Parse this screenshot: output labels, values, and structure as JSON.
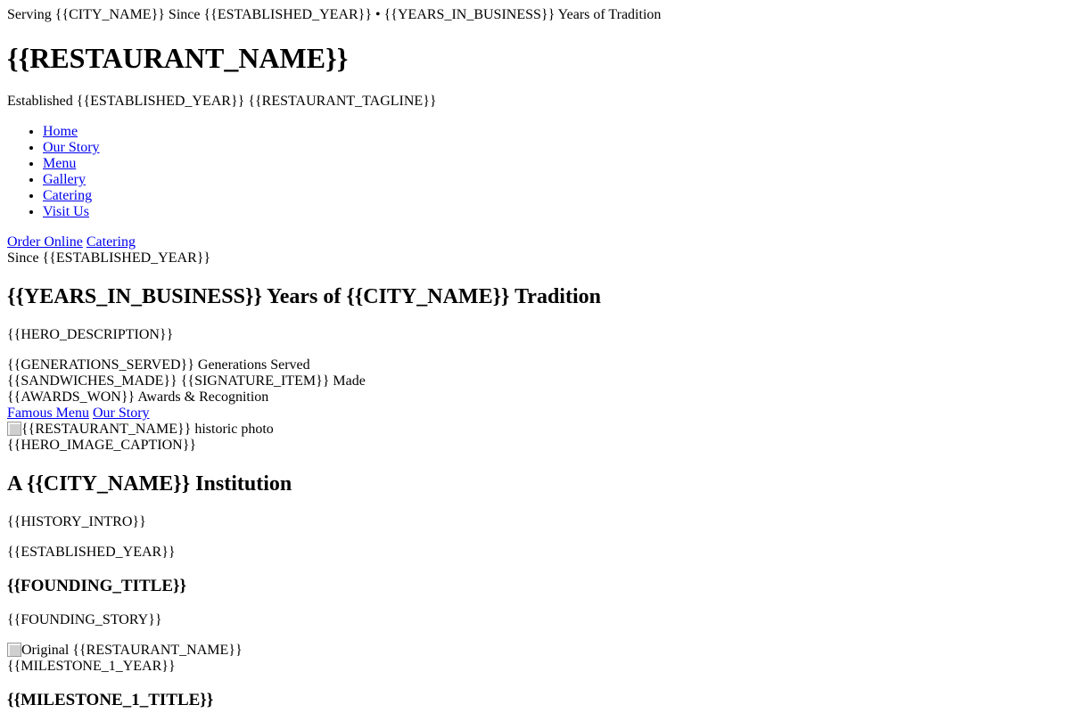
{
  "topbar": {
    "text": "Serving {{CITY_NAME}} Since {{ESTABLISHED_YEAR}} • {{YEARS_IN_BUSINESS}} Years of Tradition"
  },
  "header": {
    "title": "{{RESTAURANT_NAME}}",
    "subtitle": "Established {{ESTABLISHED_YEAR}} {{RESTAURANT_TAGLINE}}"
  },
  "nav": {
    "items": [
      {
        "label": "Home"
      },
      {
        "label": "Our Story"
      },
      {
        "label": "Menu"
      },
      {
        "label": "Gallery"
      },
      {
        "label": "Catering"
      },
      {
        "label": "Visit Us"
      }
    ]
  },
  "header_actions": {
    "order_online": "Order Online",
    "catering": "Catering"
  },
  "hero": {
    "badge": "Since {{ESTABLISHED_YEAR}}",
    "title": "{{YEARS_IN_BUSINESS}} Years of {{CITY_NAME}} Tradition",
    "description": "{{HERO_DESCRIPTION}}",
    "stats": [
      {
        "text": "{{GENERATIONS_SERVED}} Generations Served"
      },
      {
        "text": "{{SANDWICHES_MADE}} {{SIGNATURE_ITEM}} Made"
      },
      {
        "text": "{{AWARDS_WON}} Awards & Recognition"
      }
    ],
    "cta_menu": "Famous Menu",
    "cta_story": "Our Story",
    "image_alt": "{{RESTAURANT_NAME}} historic photo",
    "image_caption": "{{HERO_IMAGE_CAPTION}}"
  },
  "history": {
    "title": "A {{CITY_NAME}} Institution",
    "intro": "{{HISTORY_INTRO}}",
    "founding_year": "{{ESTABLISHED_YEAR}}",
    "founding_title": "{{FOUNDING_TITLE}}",
    "founding_story": "{{FOUNDING_STORY}}",
    "founding_image_alt": "Original {{RESTAURANT_NAME}}",
    "milestone_1_year": "{{MILESTONE_1_YEAR}}",
    "milestone_1_title": "{{MILESTONE_1_TITLE}}"
  }
}
